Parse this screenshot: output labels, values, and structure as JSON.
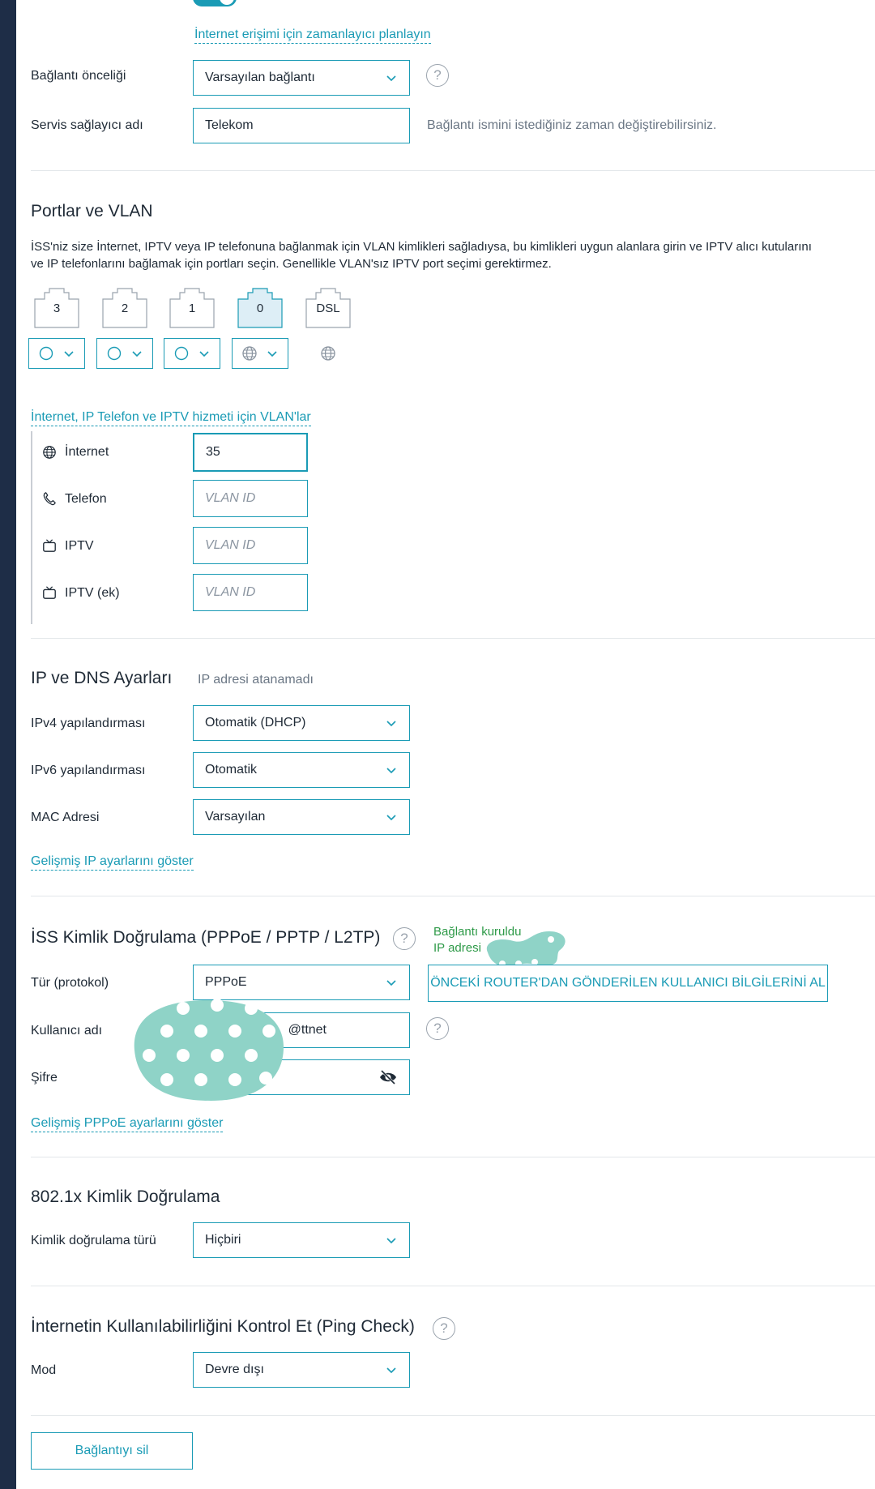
{
  "schedule_link": "İnternet erişimi için zamanlayıcı planlayın",
  "connection_priority": {
    "label": "Bağlantı önceliği",
    "value": "Varsayılan bağlantı"
  },
  "provider_name": {
    "label": "Servis sağlayıcı adı",
    "value": "Telekom",
    "hint": "Bağlantı ismini istediğiniz zaman değiştirebilirsiniz."
  },
  "ports_vlan": {
    "title": "Portlar ve VLAN",
    "description_line1": "İSS'niz size İnternet, IPTV veya IP telefonuna bağlanmak için VLAN kimlikleri sağladıysa, bu kimlikleri uygun alanlara girin ve IPTV alıcı kutularını",
    "description_line2": "ve IP telefonlarını bağlamak için portları seçin. Genellikle VLAN'sız IPTV port seçimi gerektirmez.",
    "ports": [
      "3",
      "2",
      "1",
      "0",
      "DSL"
    ],
    "vlans_link": "İnternet, IP Telefon ve IPTV hizmeti için VLAN'lar",
    "vlans": [
      {
        "label": "İnternet",
        "value": "35",
        "placeholder": "VLAN ID",
        "icon": "globe-icon"
      },
      {
        "label": "Telefon",
        "value": "",
        "placeholder": "VLAN ID",
        "icon": "phone-icon"
      },
      {
        "label": "IPTV",
        "value": "",
        "placeholder": "VLAN ID",
        "icon": "tv-icon"
      },
      {
        "label": "IPTV (ek)",
        "value": "",
        "placeholder": "VLAN ID",
        "icon": "tv-icon"
      }
    ]
  },
  "ip_dns": {
    "title": "IP ve DNS Ayarları",
    "status": "IP adresi atanamadı",
    "ipv4": {
      "label": "IPv4 yapılandırması",
      "value": "Otomatik (DHCP)"
    },
    "ipv6": {
      "label": "IPv6 yapılandırması",
      "value": "Otomatik"
    },
    "mac": {
      "label": "MAC Adresi",
      "value": "Varsayılan"
    },
    "advanced_link": "Gelişmiş IP ayarlarını göster"
  },
  "isp_auth": {
    "title": "İSS Kimlik Doğrulama (PPPoE / PPTP / L2TP)",
    "status_line1": "Bağlantı kuruldu",
    "status_line2": "IP adresi",
    "type": {
      "label": "Tür (protokol)",
      "value": "PPPoE"
    },
    "fetch_button": "ÖNCEKİ ROUTER'DAN GÖNDERİLEN KULLANICI BİLGİLERİNİ AL",
    "username": {
      "label": "Kullanıcı adı",
      "value": "@ttnet"
    },
    "password": {
      "label": "Şifre"
    },
    "advanced_link": "Gelişmiş PPPoE ayarlarını göster"
  },
  "dot1x": {
    "title": "802.1x Kimlik Doğrulama",
    "type": {
      "label": "Kimlik doğrulama türü",
      "value": "Hiçbiri"
    }
  },
  "ping_check": {
    "title": "İnternetin Kullanılabilirliğini Kontrol Et (Ping Check)",
    "mode": {
      "label": "Mod",
      "value": "Devre dışı"
    }
  },
  "delete_button": "Bağlantıyı sil",
  "colors": {
    "accent": "#1a9bb5",
    "sidebar": "#1e2d47",
    "success": "#2e9a48",
    "redaction": "#8fd3c7"
  }
}
